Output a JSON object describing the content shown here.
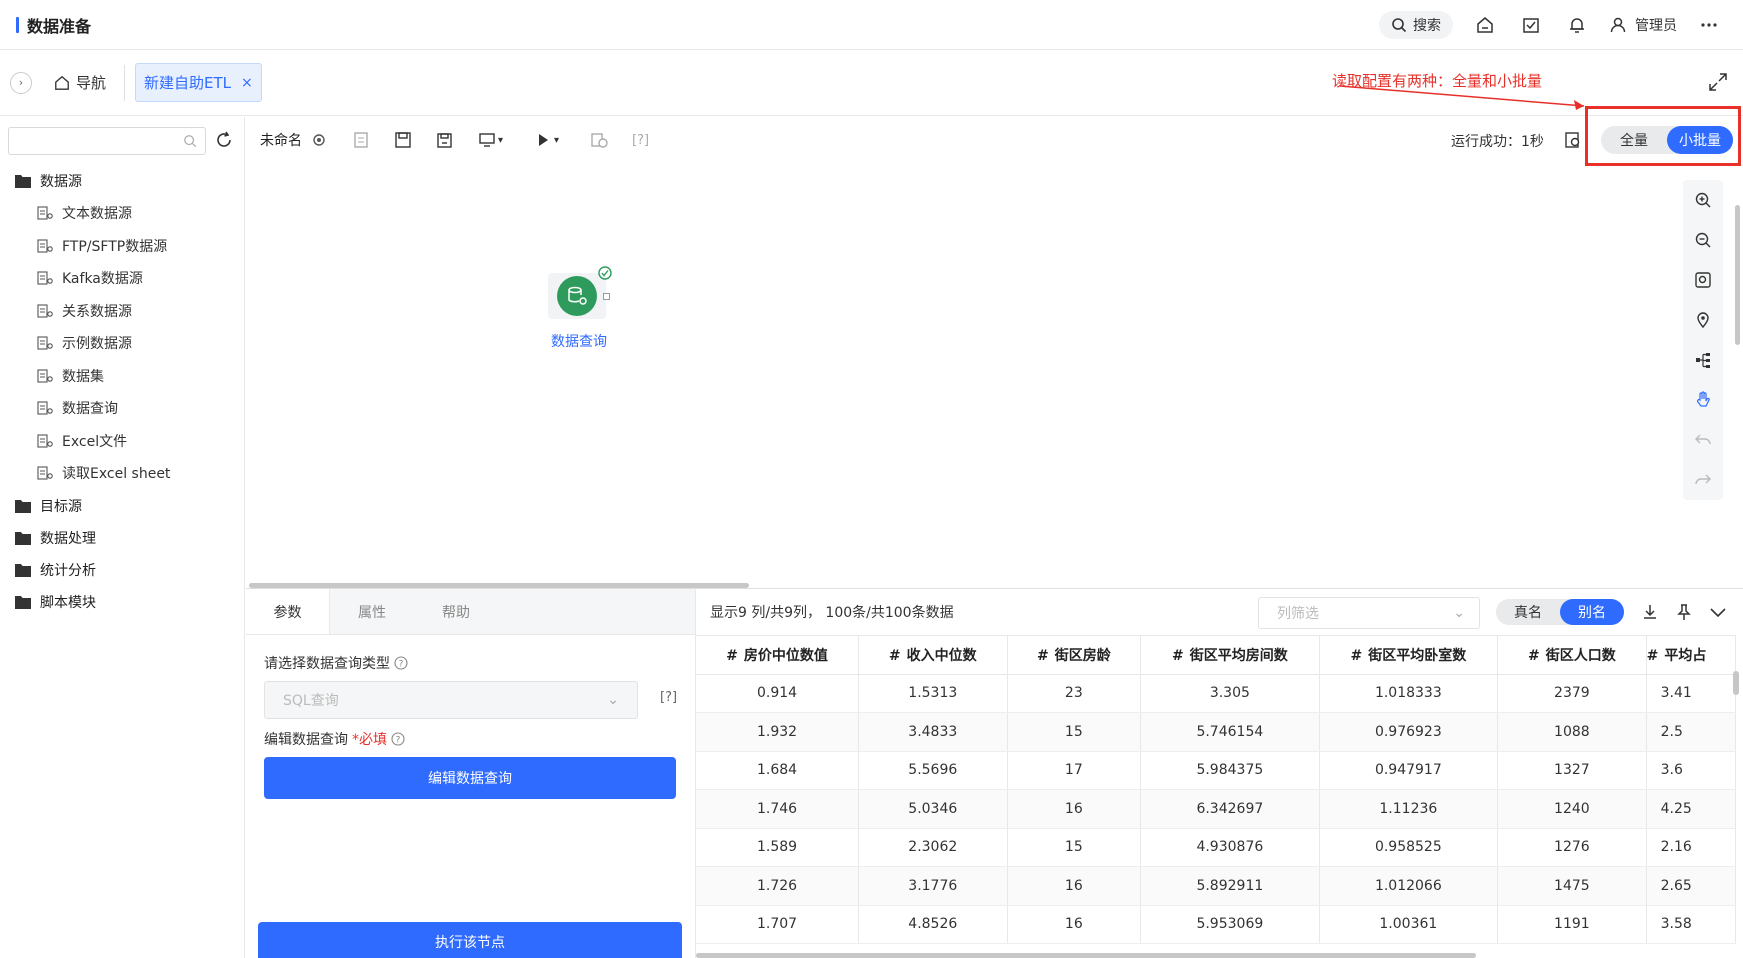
{
  "app": {
    "title": "数据准备"
  },
  "topbar": {
    "search_label": "搜索",
    "user_name": "管理员"
  },
  "tabbar": {
    "nav_label": "导航",
    "active_tab": "新建自助ETL",
    "close": "×"
  },
  "annotation": {
    "text": "读取配置有两种：全量和小批量",
    "color": "#e8302a"
  },
  "sidebar": {
    "groups": [
      {
        "label": "数据源",
        "items": [
          "文本数据源",
          "FTP/SFTP数据源",
          "Kafka数据源",
          "关系数据源",
          "示例数据源",
          "数据集",
          "数据查询",
          "Excel文件",
          "读取Excel sheet"
        ]
      },
      {
        "label": "目标源"
      },
      {
        "label": "数据处理"
      },
      {
        "label": "统计分析"
      },
      {
        "label": "脚本模块"
      }
    ]
  },
  "toolbar": {
    "flow_name": "未命名",
    "run_status": "运行成功：1秒",
    "help": "[?]",
    "mode": {
      "full": "全量",
      "batch": "小批量",
      "selected": "小批量"
    }
  },
  "canvas": {
    "node_label": "数据查询",
    "node_status": "success"
  },
  "panel": {
    "tabs": [
      "参数",
      "属性",
      "帮助"
    ],
    "query_type_label": "请选择数据查询类型",
    "query_type_value": "SQL查询",
    "help_bracket": "[?]",
    "edit_label": "编辑数据查询",
    "required_mark": "*必填",
    "edit_button": "编辑数据查询",
    "run_button": "执行该节点"
  },
  "preview": {
    "info": "显示9 列/共9列， 100条/共100条数据",
    "column_filter_placeholder": "列筛选",
    "name_toggle": {
      "real": "真名",
      "alias": "别名",
      "selected": "别名"
    },
    "columns": [
      "房价中位数值",
      "收入中位数",
      "街区房龄",
      "街区平均房间数",
      "街区平均卧室数",
      "街区人口数",
      "平均占"
    ],
    "rows": [
      [
        "0.914",
        "1.5313",
        "23",
        "3.305",
        "1.018333",
        "2379",
        "3.41"
      ],
      [
        "1.932",
        "3.4833",
        "15",
        "5.746154",
        "0.976923",
        "1088",
        "2.5"
      ],
      [
        "1.684",
        "5.5696",
        "17",
        "5.984375",
        "0.947917",
        "1327",
        "3.6"
      ],
      [
        "1.746",
        "5.0346",
        "16",
        "6.342697",
        "1.11236",
        "1240",
        "4.25"
      ],
      [
        "1.589",
        "2.3062",
        "15",
        "4.930876",
        "0.958525",
        "1276",
        "2.16"
      ],
      [
        "1.726",
        "3.1776",
        "16",
        "5.892911",
        "1.012066",
        "1475",
        "2.65"
      ],
      [
        "1.707",
        "4.8526",
        "16",
        "5.953069",
        "1.00361",
        "1191",
        "3.58"
      ]
    ]
  },
  "colors": {
    "primary": "#2f6bff",
    "success": "#2e9b5d",
    "highlight": "#e8302a"
  }
}
